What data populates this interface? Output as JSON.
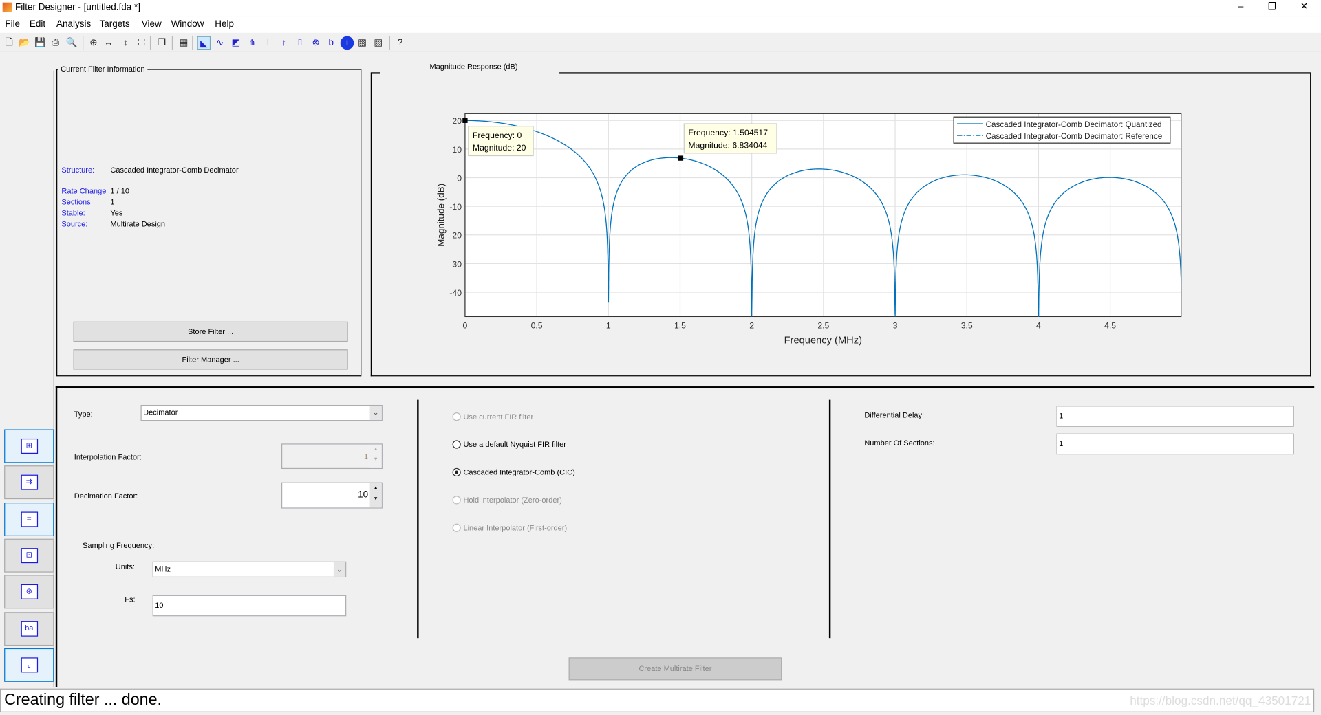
{
  "window": {
    "title": "Filter Designer -  [untitled.fda *]",
    "minimize": "–",
    "maximize": "❐",
    "close": "✕"
  },
  "menu": [
    "File",
    "Edit",
    "Analysis",
    "Targets",
    "View",
    "Window",
    "Help"
  ],
  "toolbar": [
    "new-icon",
    "open-icon",
    "save-icon",
    "print-icon",
    "print-preview-icon",
    "zoom-in-icon",
    "zoom-x-icon",
    "zoom-y-icon",
    "full-view-icon",
    "new-window-icon",
    "filter-structure-icon",
    "magnitude-response-icon",
    "phase-response-icon",
    "magnitude-phase-icon",
    "group-delay-icon",
    "phase-delay-icon",
    "impulse-response-icon",
    "step-response-icon",
    "pole-zero-icon",
    "coefficients-icon",
    "info-icon",
    "quantize-icon",
    "noise-icon",
    "whats-this-icon"
  ],
  "filter_info": {
    "title": "Current Filter Information",
    "rows": [
      {
        "k": "Structure:",
        "v": "Cascaded Integrator-Comb Decimator"
      },
      {
        "k": "Rate Change",
        "v": "1 / 10"
      },
      {
        "k": "Sections",
        "v": "1"
      },
      {
        "k": "Stable:",
        "v": "Yes"
      },
      {
        "k": "Source:",
        "v": "Multirate Design"
      }
    ],
    "store_button": "Store Filter ...",
    "manager_button": "Filter Manager ..."
  },
  "plot_panel": {
    "title": "Magnitude Response (dB)"
  },
  "chart_data": {
    "type": "line",
    "xlabel": "Frequency (MHz)",
    "ylabel": "Magnitude (dB)",
    "xlim": [
      0,
      4.995
    ],
    "ylim": [
      -48.5,
      22.4
    ],
    "xticks": [
      "0",
      "0.5",
      "1",
      "1.5",
      "2",
      "2.5",
      "3",
      "3.5",
      "4",
      "4.5"
    ],
    "xtick_values": [
      0,
      0.5,
      1,
      1.5,
      2,
      2.5,
      3,
      3.5,
      4,
      4.5
    ],
    "yticks": [
      "20",
      "10",
      "0",
      "-10",
      "-20",
      "-30",
      "-40"
    ],
    "ytick_values": [
      20,
      10,
      0,
      -10,
      -20,
      -30,
      -40
    ],
    "grid": true,
    "legend_position": "top-right",
    "series": [
      {
        "name": "Cascaded Integrator-Comb Decimator: Quantized",
        "style": "solid",
        "color": "#0072bd"
      },
      {
        "name": "Cascaded Integrator-Comb Decimator: Reference",
        "style": "dash-dot",
        "color": "#0072bd"
      }
    ],
    "cic": {
      "decimation": 10,
      "differential_delay": 1,
      "sections": 1,
      "fs_mhz": 10
    },
    "datatips": [
      {
        "x": 0,
        "y": 20,
        "l1": "Frequency: 0",
        "l2": "Magnitude: 20"
      },
      {
        "x": 1.504517,
        "y": 6.834044,
        "l1": "Frequency: 1.504517",
        "l2": "Magnitude: 6.834044"
      }
    ]
  },
  "sidebar": [
    "multirate-icon",
    "transform-icon",
    "quantization-icon",
    "realize-model-icon",
    "pole-zero-editor-icon",
    "import-icon",
    "design-filter-icon"
  ],
  "design": {
    "type_label": "Type:",
    "type_value": "Decimator",
    "interp_label": "Interpolation Factor:",
    "interp_value": "1",
    "decim_label": "Decimation Factor:",
    "decim_value": "10",
    "fs_group": "Sampling Frequency:",
    "units_label": "Units:",
    "units_value": "MHz",
    "fs_label": "Fs:",
    "fs_value": "10",
    "radios": [
      {
        "label": "Use current FIR filter",
        "enabled": false,
        "checked": false
      },
      {
        "label": "Use a default Nyquist FIR filter",
        "enabled": true,
        "checked": false
      },
      {
        "label": "Cascaded Integrator-Comb (CIC)",
        "enabled": true,
        "checked": true
      },
      {
        "label": "Hold interpolator (Zero-order)",
        "enabled": false,
        "checked": false
      },
      {
        "label": "Linear Interpolator (First-order)",
        "enabled": false,
        "checked": false
      }
    ],
    "diff_delay_label": "Differential Delay:",
    "diff_delay_value": "1",
    "num_sections_label": "Number Of Sections:",
    "num_sections_value": "1",
    "create_button": "Create Multirate Filter"
  },
  "status": "Creating filter ... done.",
  "watermark": "https://blog.csdn.net/qq_43501721"
}
